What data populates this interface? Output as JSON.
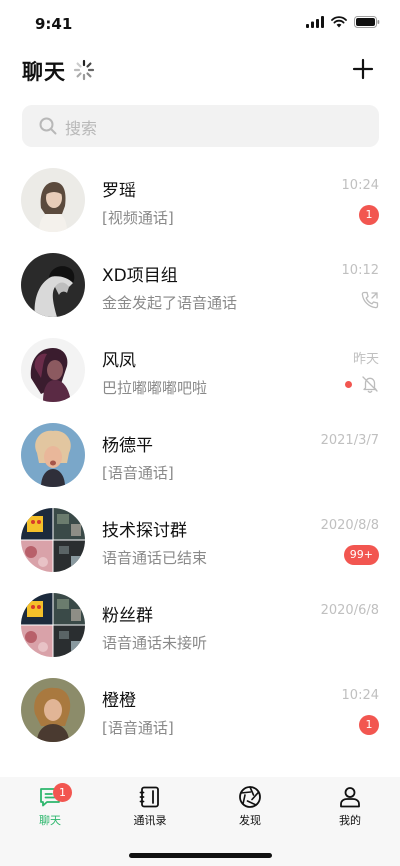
{
  "status_bar": {
    "time": "9:41"
  },
  "header": {
    "title": "聊天"
  },
  "search": {
    "placeholder": "搜索"
  },
  "colors": {
    "accent": "#2cb66c",
    "badge": "#f25650",
    "search_bg": "#f2f2f2",
    "tab_bg": "#f7f7f7"
  },
  "chats": [
    {
      "name": "罗瑶",
      "preview": "[视频通话]",
      "time": "10:24",
      "badge": "1",
      "avatar": "woman-portrait"
    },
    {
      "name": "XD项目组",
      "preview": "金金发起了语音通话",
      "time": "10:12",
      "indicator": "phone-call-icon",
      "avatar": "bw-profile-portrait"
    },
    {
      "name": "风凤",
      "preview": "巴拉嘟嘟嘟吧啦",
      "time": "昨天",
      "indicator": "bell-muted-icon",
      "avatar": "woman-dark-portrait"
    },
    {
      "name": "杨德平",
      "preview": "[语音通话]",
      "time": "2021/3/7",
      "avatar": "blue-background-portrait"
    },
    {
      "name": "技术探讨群",
      "preview": "语音通话已结束",
      "time": "2020/8/8",
      "badge": "99+",
      "avatar": "group-collage"
    },
    {
      "name": "粉丝群",
      "preview": "语音通话未接听",
      "time": "2020/6/8",
      "avatar": "group-collage"
    },
    {
      "name": "橙橙",
      "preview": "[语音通话]",
      "time": "10:24",
      "badge": "1",
      "avatar": "woman-outdoor-portrait"
    }
  ],
  "tabs": [
    {
      "label": "聊天",
      "icon": "chat-bubble-icon",
      "active": true,
      "badge": "1"
    },
    {
      "label": "通讯录",
      "icon": "contacts-book-icon",
      "active": false
    },
    {
      "label": "发现",
      "icon": "aperture-icon",
      "active": false
    },
    {
      "label": "我的",
      "icon": "person-icon",
      "active": false
    }
  ]
}
